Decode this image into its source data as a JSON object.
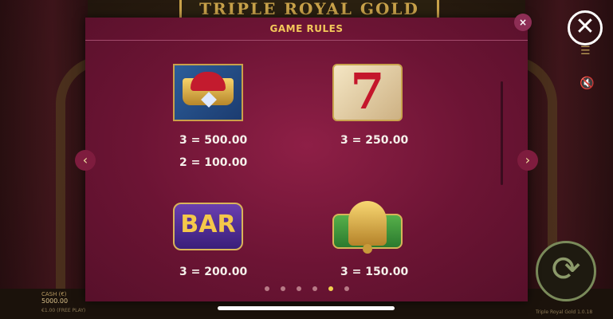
{
  "background": {
    "game_title": "TRIPLE ROYAL GOLD",
    "credit_label": "CASH (€)",
    "credit_value": "5000.00",
    "bet_info": "€1.00 (FREE PLAY)",
    "version_info": "Triple Royal Gold 1.0.18"
  },
  "controls": {
    "close_icon": "close-icon",
    "menu_icon": "menu-icon",
    "mute_icon": "mute-icon",
    "spin_icon": "spin-icon"
  },
  "modal": {
    "title": "GAME RULES",
    "close_label": "×",
    "prev_label": "‹",
    "next_label": "›",
    "symbols": [
      {
        "name": "crown",
        "payouts": [
          "3 = 500.00",
          "2 = 100.00"
        ]
      },
      {
        "name": "seven",
        "symbol_text": "7",
        "payouts": [
          "3 = 250.00"
        ]
      },
      {
        "name": "bar",
        "symbol_text": "BAR",
        "payouts": [
          "3 = 200.00"
        ]
      },
      {
        "name": "bell",
        "payouts": [
          "3 = 150.00"
        ]
      }
    ],
    "pagination": {
      "total": 6,
      "active_index": 4
    }
  },
  "colors": {
    "modal_bg": "#6c1434",
    "title_gold": "#f3c85a",
    "active_dot": "#f2d04e"
  }
}
